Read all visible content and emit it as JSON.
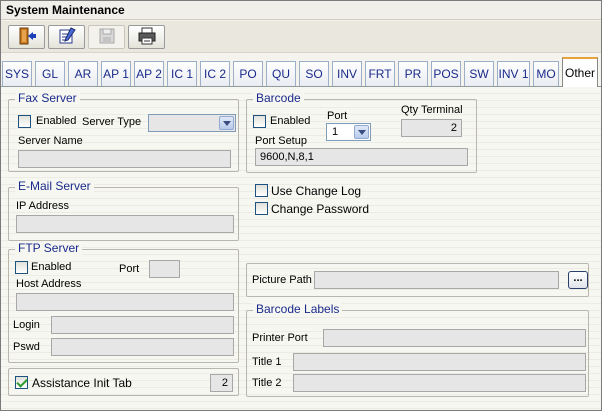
{
  "window": {
    "title": "System Maintenance"
  },
  "toolbar": {
    "buttons": [
      {
        "name": "exit-icon"
      },
      {
        "name": "edit-icon"
      },
      {
        "name": "save-icon"
      },
      {
        "name": "printer-icon"
      }
    ]
  },
  "tabs": [
    "SYS",
    "GL",
    "AR",
    "AP 1",
    "AP 2",
    "IC 1",
    "IC 2",
    "PO",
    "QU",
    "SO",
    "INV",
    "FRT",
    "PR",
    "POS",
    "SW",
    "INV 1",
    "MO",
    "Other"
  ],
  "active_tab": "Other",
  "fax_server": {
    "legend": "Fax Server",
    "enabled_label": "Enabled",
    "enabled": false,
    "server_type_label": "Server Type",
    "server_type_value": "",
    "server_name_label": "Server Name",
    "server_name_value": ""
  },
  "barcode": {
    "legend": "Barcode",
    "enabled_label": "Enabled",
    "enabled": false,
    "port_label": "Port",
    "port_value": "1",
    "qty_terminal_label": "Qty Terminal",
    "qty_terminal_value": "2",
    "port_setup_label": "Port Setup",
    "port_setup_value": "9600,N,8,1"
  },
  "email_server": {
    "legend": "E-Mail Server",
    "ip_address_label": "IP Address",
    "ip_address_value": ""
  },
  "options": {
    "use_change_log_label": "Use Change Log",
    "use_change_log": false,
    "change_password_label": "Change Password",
    "change_password": false
  },
  "ftp_server": {
    "legend": "FTP Server",
    "enabled_label": "Enabled",
    "enabled": false,
    "port_label": "Port",
    "port_value": "",
    "host_address_label": "Host Address",
    "host_address_value": "",
    "login_label": "Login",
    "login_value": "",
    "pswd_label": "Pswd",
    "pswd_value": ""
  },
  "assistance": {
    "label": "Assistance Init Tab",
    "checked": true,
    "value": "2"
  },
  "picture_path": {
    "label": "Picture Path",
    "value": "",
    "browse_label": "..."
  },
  "barcode_labels": {
    "legend": "Barcode Labels",
    "printer_port_label": "Printer Port",
    "printer_port_value": "",
    "title1_label": "Title 1",
    "title1_value": "",
    "title2_label": "Title 2",
    "title2_value": ""
  },
  "colors": {
    "tab_text": "#1a2a8a",
    "legend_text": "#1a2a8a",
    "active_tab_accent": "#e8a23a",
    "check_mark": "#2b9a2b"
  }
}
